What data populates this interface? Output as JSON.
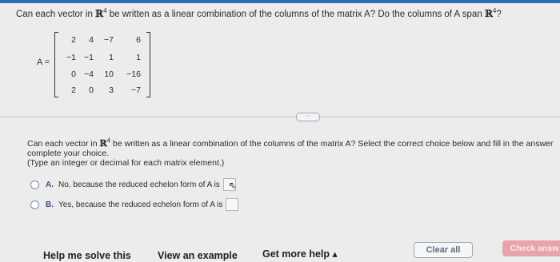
{
  "question": {
    "prefix": "Can each vector in ",
    "space": "ℝ",
    "exp": "4",
    "middle": " be written as a linear combination of the columns of the matrix A? Do the columns of A span ",
    "space2": "ℝ",
    "exp2": "4",
    "suffix": "?"
  },
  "matrix": {
    "label": "A =",
    "rows": [
      [
        "2",
        "4",
        "−7",
        "6"
      ],
      [
        "−1",
        "−1",
        "1",
        "1"
      ],
      [
        "0",
        "−4",
        "10",
        "−16"
      ],
      [
        "2",
        "0",
        "3",
        "−7"
      ]
    ]
  },
  "more_pill": "⋯",
  "part2": {
    "line1_prefix": "Can each vector in ",
    "space": "ℝ",
    "exp": "4",
    "line1_suffix": " be written as a linear combination of the columns of the matrix A? Select the correct choice below and fill in the answer",
    "line2": "complete your choice.",
    "line3": "(Type an integer or decimal for each matrix element.)"
  },
  "choices": [
    {
      "letter": "A.",
      "text": "No, because the reduced echelon form of A is"
    },
    {
      "letter": "B.",
      "text": "Yes, because the reduced echelon form of A is"
    }
  ],
  "footer": {
    "help": "Help me solve this",
    "example": "View an example",
    "more_help": "Get more help ▴",
    "clear": "Clear all",
    "check": "Check answ"
  }
}
